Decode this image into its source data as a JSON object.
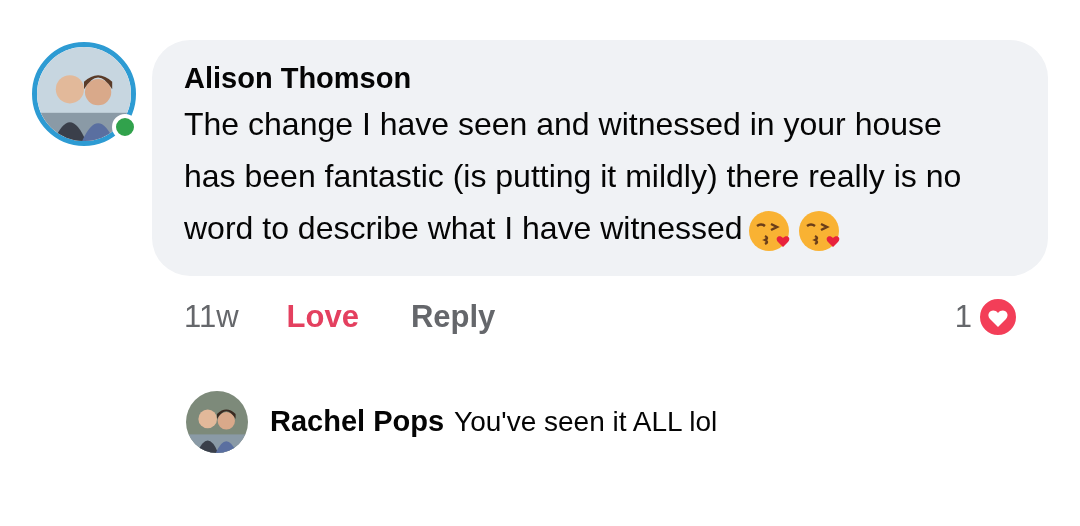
{
  "comment": {
    "author": "Alison Thomson",
    "online": true,
    "text": "The change I have seen and witnessed in your house has been fantastic (is putting it mildly) there really is no word to describe what I have witnessed",
    "time": "11w",
    "actions": [
      {
        "label": "Love",
        "selected": true
      },
      {
        "label": "Reply",
        "selected": false
      }
    ],
    "reaction_count": "1"
  },
  "reply": {
    "author": "Rachel Pops",
    "text": "You've seen it ALL lol"
  }
}
